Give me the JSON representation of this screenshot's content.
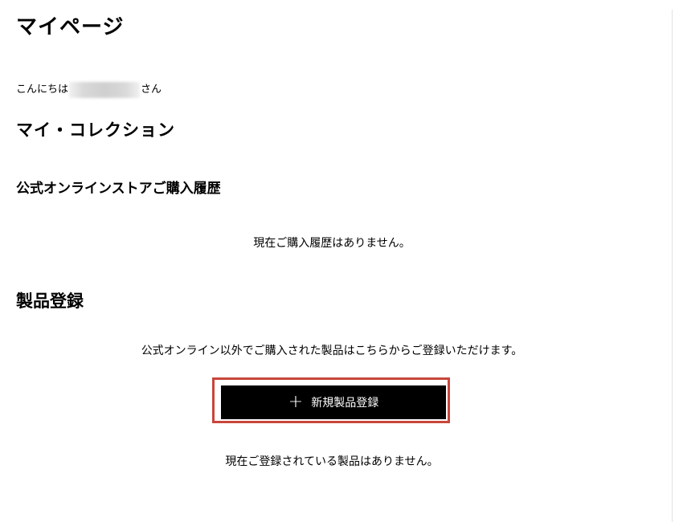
{
  "page_title": "マイページ",
  "greeting": {
    "prefix": "こんにちは",
    "suffix": "さん"
  },
  "collection": {
    "title": "マイ・コレクション"
  },
  "purchase_history": {
    "title": "公式オンラインストアご購入履歴",
    "empty_message": "現在ご購入履歴はありません。"
  },
  "product_registration": {
    "title": "製品登録",
    "note": "公式オンライン以外でご購入された製品はこちらからご登録いただけます。",
    "button_icon": "plus-icon",
    "button_label": "新規製品登録",
    "empty_message": "現在ご登録されている製品はありません。"
  },
  "colors": {
    "button_background": "#000000",
    "button_text": "#ffffff",
    "highlight_border": "#c8463b"
  }
}
